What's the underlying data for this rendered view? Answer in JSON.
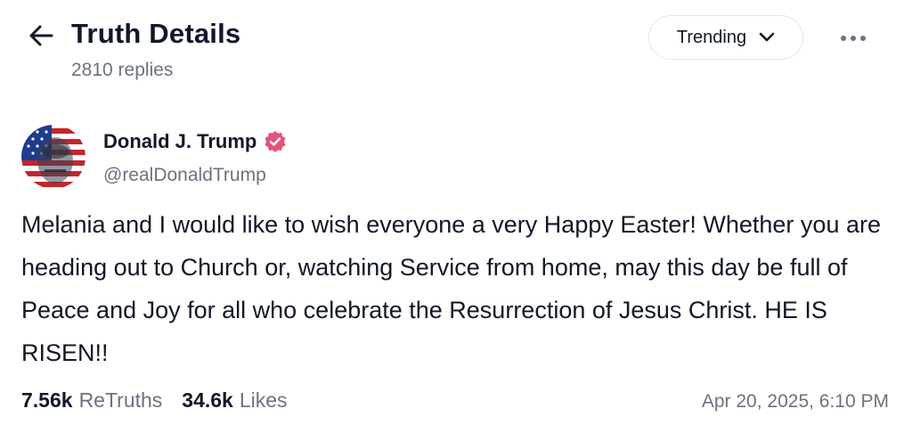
{
  "header": {
    "title": "Truth Details",
    "subtitle": "2810 replies",
    "sort_label": "Trending"
  },
  "post": {
    "author": {
      "name": "Donald J. Trump",
      "handle": "@realDonaldTrump",
      "verified": true,
      "badge_color": "#e2537a"
    },
    "text": "Melania and I would like to wish everyone a very Happy Easter! Whether you are heading out to Church or, watching Service from home, may this day be full of Peace and Joy for all who celebrate the Resurrection of Jesus Christ. HE IS RISEN!!",
    "stats": {
      "retruths_count": "7.56k",
      "retruths_label": "ReTruths",
      "likes_count": "34.6k",
      "likes_label": "Likes"
    },
    "timestamp": "Apr 20, 2025, 6:10 PM"
  },
  "icons": {
    "back": "arrow-left-icon",
    "sort": "chevron-down-icon",
    "more": "more-horizontal-icon",
    "verified": "verified-badge-icon"
  }
}
